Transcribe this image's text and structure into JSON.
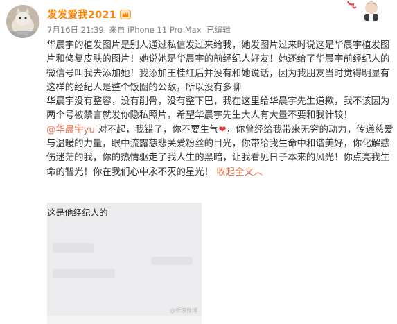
{
  "post": {
    "username": "发发爱我2021",
    "meta": {
      "date": "7月16日 21:39",
      "source": "来自 iPhone 11 Pro Max",
      "edited": "已编辑"
    },
    "paragraph1": "华晨宇的植发图片是别人通过私信发过来给我，她发图片过来时说这是华晨宇植发图片和修复皮肤的图片！她说她是华晨宇的前经纪人好友！她还给了华晨宇前经纪人的微信号叫我去添加她！我添加王桂红后并没有和她说话，因为我朋友当时觉得明显有这样的经纪人是整个饭圈的公敌，所以没有多聊",
    "paragraph2": "华晨宇没有整容，没有削骨，没有整下巴，我在这里给华晨宇先生道歉，我不该因为两个号被禁言就发你隐私照片，希望华晨宇先生大人有大量不要和我计较！",
    "mention": "@华晨宇yu",
    "paragraph3_a": " 对不起，我错了，你不要生气",
    "heart": "❤",
    "paragraph3_b": "，你曾经给我带来无穷的动力，传递慈爱与温暖的力量，眼中流露慈悲关爱粉丝的目光，你带给我生命中和谐美好，你化解感伤迷茫的我，你的热情驱走了我人生的黑暗，让我看见日子本来的风光！你点亮我生命的智光！你在我们心中永不灭的星光！",
    "expand_label": "收起全文",
    "expand_chevron": "︿"
  },
  "image": {
    "top_text": "这是他经纪人的",
    "watermark": "@新浪微博"
  },
  "colors": {
    "username": "#ff8200",
    "link": "#eb7350",
    "heart": "#e8333c"
  },
  "icons": [
    "avatar",
    "member-crown-icon",
    "corner-profile-tag"
  ]
}
